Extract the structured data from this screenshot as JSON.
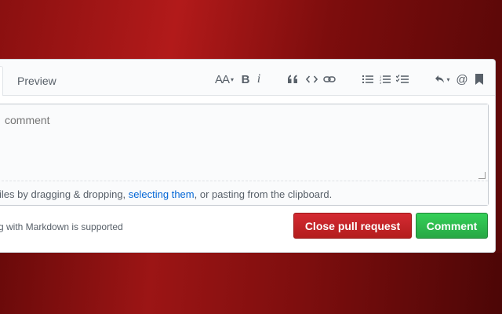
{
  "tabs": {
    "preview_label": "Preview"
  },
  "toolbar": {
    "icons": [
      "text-size-icon",
      "bold-icon",
      "italic-icon",
      "quote-icon",
      "code-icon",
      "link-icon",
      "bullet-list-icon",
      "numbered-list-icon",
      "task-list-icon",
      "reply-icon",
      "mention-icon",
      "bookmark-icon"
    ],
    "text_size_glyph": "AA",
    "bold_glyph": "B",
    "italic_glyph": "i",
    "mention_glyph": "@"
  },
  "editor": {
    "placeholder": "comment",
    "attach_prefix": "iles by dragging & dropping, ",
    "attach_link": "selecting them",
    "attach_suffix": ", or pasting from the clipboard."
  },
  "footer": {
    "markdown_note": "g with Markdown is supported",
    "close_button": "Close pull request",
    "comment_button": "Comment"
  },
  "colors": {
    "close_button": "#cb2431",
    "comment_button": "#2cbe4e",
    "link": "#0366d6",
    "background": "#8a1010"
  }
}
